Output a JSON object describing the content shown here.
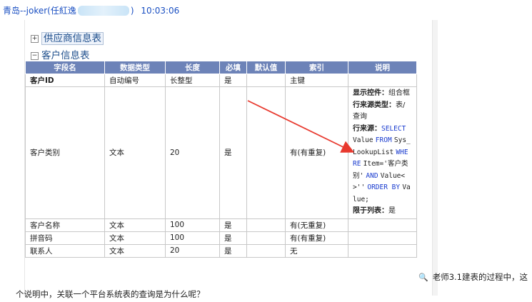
{
  "header": {
    "sender": "青岛--joker(任紅逸",
    "sender_tail": ")",
    "time": "10:03:06"
  },
  "tree": [
    {
      "label": "供应商信息表",
      "expander": "+"
    },
    {
      "label": "客户信息表",
      "expander": "−"
    }
  ],
  "table": {
    "columns": [
      "字段名",
      "数据类型",
      "长度",
      "必填",
      "默认值",
      "索引",
      "说明"
    ],
    "rows": [
      {
        "name": "客户ID",
        "type": "自动编号",
        "length": "长整型",
        "required": "是",
        "default": "",
        "index": "主键",
        "note": ""
      },
      {
        "name": "客户类别",
        "type": "文本",
        "length": "20",
        "required": "是",
        "default": "",
        "index": "有(有重复)",
        "note": "desc"
      },
      {
        "name": "客户名称",
        "type": "文本",
        "length": "100",
        "required": "是",
        "default": "",
        "index": "有(无重复)",
        "note": ""
      },
      {
        "name": "拼音码",
        "type": "文本",
        "length": "100",
        "required": "是",
        "default": "",
        "index": "有(有重复)",
        "note": ""
      },
      {
        "name": "联系人",
        "type": "文本",
        "length": "20",
        "required": "是",
        "default": "",
        "index": "无",
        "note": ""
      }
    ],
    "description": {
      "control_label": "显示控件：",
      "control_value": "组合框",
      "row_source_type_label": "行来源类型：",
      "row_source_type_value": "表/查询",
      "row_source_label": "行来源：",
      "sql_select": "SELECT",
      "sql_value": "Value",
      "sql_from": "FROM",
      "sql_table": "Sys_LookupList",
      "sql_where": "WHERE",
      "sql_cond": "Item='客户类别'",
      "sql_and": "AND",
      "sql_cond2": "Value<>''",
      "sql_order": "ORDER BY",
      "sql_end": "Value;",
      "limit_label": "限于列表：",
      "limit_value": "是"
    }
  },
  "question": {
    "line1": "老师3.1建表的过程中，这",
    "line2": "个说明中，关联一个平台系统表的查询是为什么呢？"
  },
  "colors": {
    "header_text": "#1a4fc2",
    "table_header_bg": "#6d83b8",
    "sql_keyword": "#1a3ccf",
    "arrow": "#e8392e"
  }
}
